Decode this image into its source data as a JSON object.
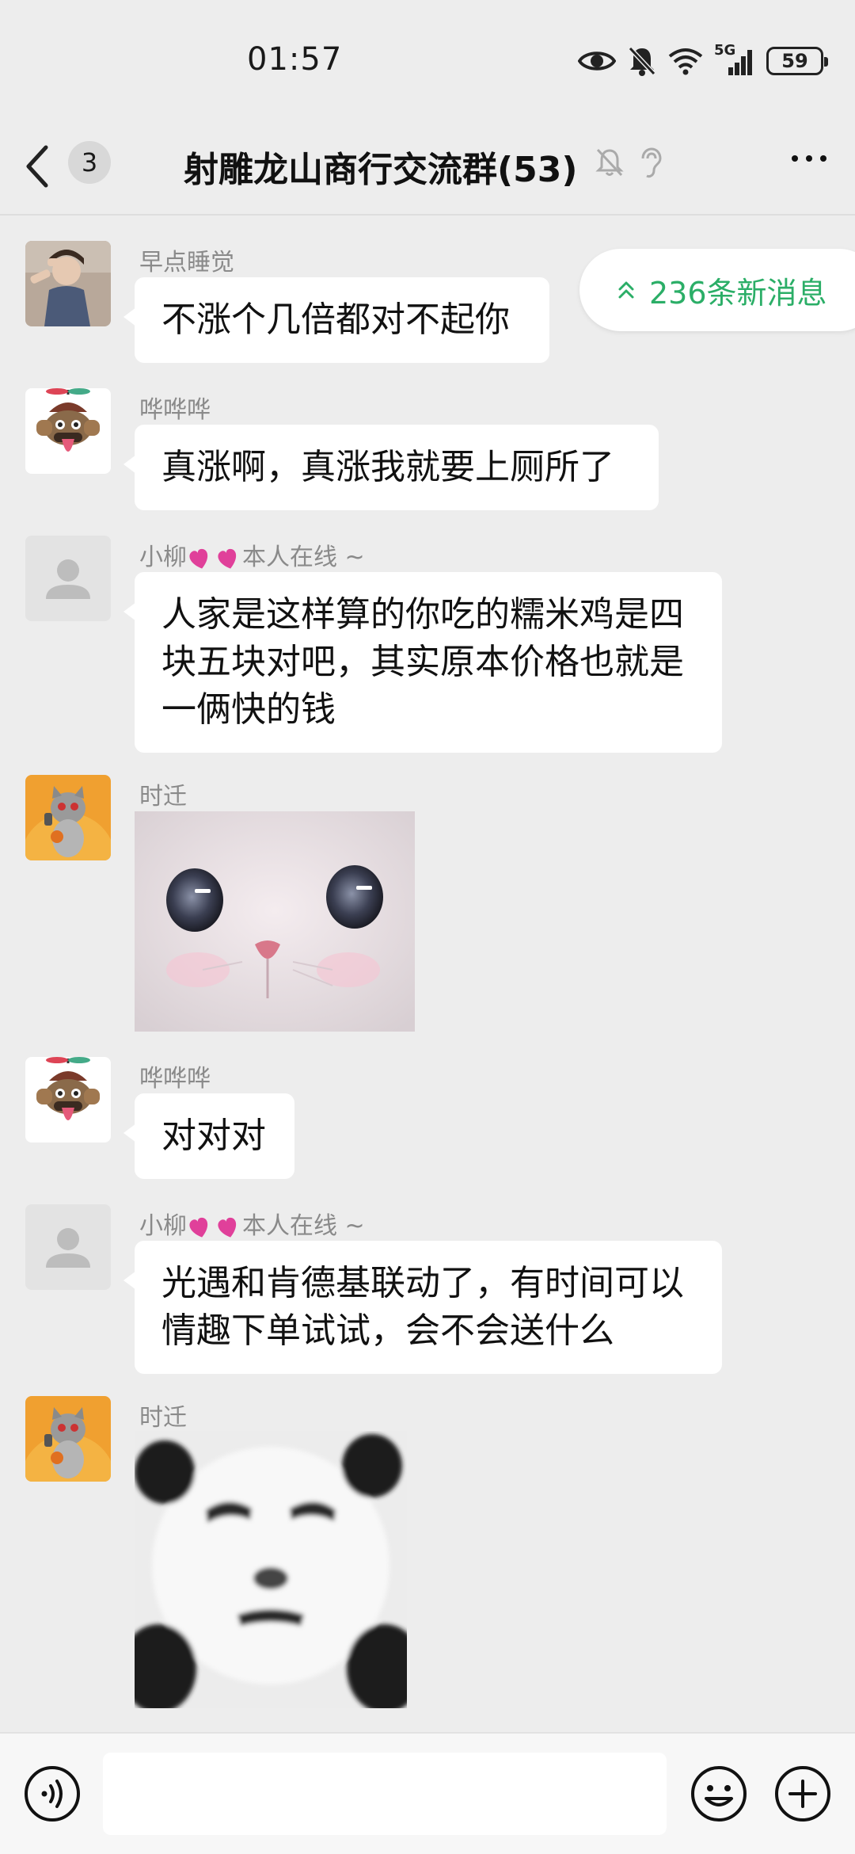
{
  "status_bar": {
    "time": "01:57",
    "network": "5G",
    "battery": "59"
  },
  "header": {
    "unread_count": "3",
    "title": "射雕龙山商行交流群(53)"
  },
  "new_messages": {
    "label": "236条新消息"
  },
  "messages": [
    {
      "sender": "早点睡觉",
      "type": "text",
      "lines": [
        "不涨个几倍都对不起你"
      ]
    },
    {
      "sender": "哗哗哗",
      "type": "text",
      "lines": [
        "真涨啊，真涨我就要上厕所了"
      ]
    },
    {
      "sender_name": "小柳",
      "sender_suffix": "本人在线 ~",
      "type": "text",
      "lines": [
        "人家是这样算的你吃的糯米鸡是四",
        "块五块对吧，其实原本价格也就是",
        "一俩快的钱"
      ]
    },
    {
      "sender": "时迁",
      "type": "sticker",
      "sticker": "cat-face-sticker"
    },
    {
      "sender": "哗哗哗",
      "type": "text",
      "lines": [
        "对对对"
      ]
    },
    {
      "sender_name": "小柳",
      "sender_suffix": "本人在线 ~",
      "type": "text",
      "lines": [
        "光遇和肯德基联动了，有时间可以",
        "情趣下单试试，会不会送什么"
      ]
    },
    {
      "sender": "时迁",
      "type": "sticker",
      "sticker": "panda-meme-sticker"
    }
  ],
  "input": {
    "placeholder": ""
  }
}
